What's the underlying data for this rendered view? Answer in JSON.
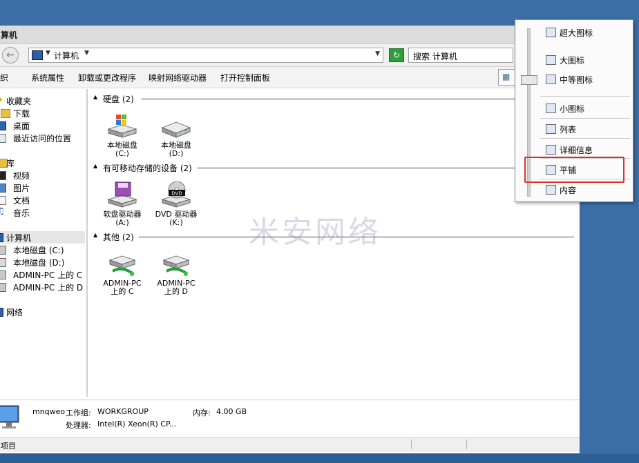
{
  "window": {
    "title": "算机",
    "address": {
      "segment": "计算机"
    },
    "search_placeholder": "搜索 计算机"
  },
  "toolbar": {
    "items": [
      "织",
      "系统属性",
      "卸载或更改程序",
      "映射网络驱动器",
      "打开控制面板"
    ]
  },
  "sidebar": {
    "items": [
      {
        "label": "收藏夹",
        "icon": "star-icon"
      },
      {
        "label": "下载",
        "icon": "download-folder-icon"
      },
      {
        "label": "桌面",
        "icon": "desktop-icon"
      },
      {
        "label": "最近访问的位置",
        "icon": "recent-places-icon"
      },
      {
        "label": "库",
        "icon": "library-icon"
      },
      {
        "label": "视频",
        "icon": "video-icon"
      },
      {
        "label": "图片",
        "icon": "pictures-icon"
      },
      {
        "label": "文档",
        "icon": "documents-icon"
      },
      {
        "label": "音乐",
        "icon": "music-icon"
      },
      {
        "label": "计算机",
        "icon": "computer-icon"
      },
      {
        "label": "本地磁盘 (C:)",
        "icon": "drive-icon"
      },
      {
        "label": "本地磁盘 (D:)",
        "icon": "drive-icon"
      },
      {
        "label": "ADMIN-PC 上的 C",
        "icon": "network-drive-icon"
      },
      {
        "label": "ADMIN-PC 上的 D",
        "icon": "network-drive-icon"
      },
      {
        "label": "网络",
        "icon": "network-icon"
      }
    ]
  },
  "groups": [
    {
      "title": "硬盘 (2)",
      "items": [
        {
          "line1": "本地磁盘",
          "line2": "(C:)"
        },
        {
          "line1": "本地磁盘",
          "line2": "(D:)"
        }
      ]
    },
    {
      "title": "有可移动存储的设备 (2)",
      "items": [
        {
          "line1": "软盘驱动器",
          "line2": "(A:)"
        },
        {
          "line1": "DVD 驱动器",
          "line2": "(K:)"
        }
      ]
    },
    {
      "title": "其他 (2)",
      "items": [
        {
          "line1": "ADMIN-PC",
          "line2": "上的 C"
        },
        {
          "line1": "ADMIN-PC",
          "line2": "上的 D"
        }
      ]
    }
  ],
  "dvd_badge": "DVD",
  "watermark": "米安网络",
  "details": {
    "computer_name": "mnqweo",
    "workgroup_label": "工作组:",
    "workgroup_value": "WORKGROUP",
    "memory_label": "内存:",
    "memory_value": "4.00 GB",
    "processor_label": "处理器:",
    "processor_value": "Intel(R) Xeon(R) CP..."
  },
  "statusbar": {
    "text": "项目"
  },
  "view_menu": {
    "items": [
      "超大图标",
      "大图标",
      "中等图标",
      "小图标",
      "列表",
      "详细信息",
      "平铺",
      "内容"
    ],
    "selected": "中等图标",
    "highlighted": "平铺"
  }
}
